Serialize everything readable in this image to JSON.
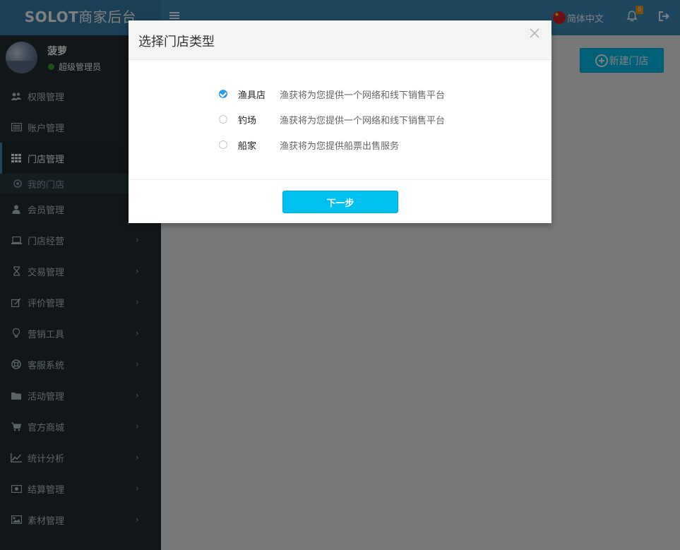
{
  "header": {
    "logo_latin": "SOLOT",
    "logo_cn": "商家后台",
    "hamburger_icon": "menu-icon",
    "language": "简体中文",
    "notification_count": "0",
    "colors": {
      "header": "#3c8dbc",
      "logo_bg": "#367fa9"
    }
  },
  "sidebar": {
    "user": {
      "name": "菠萝",
      "role": "超级管理员",
      "status_color": "#3c9a3c"
    },
    "items": [
      {
        "label": "权限管理",
        "icon": "users-icon"
      },
      {
        "label": "账户管理",
        "icon": "card-icon"
      },
      {
        "label": "门店管理",
        "icon": "grid-icon",
        "active": true
      },
      {
        "label": "我的门店",
        "icon": "circle-dot-icon",
        "sub": true
      },
      {
        "label": "会员管理",
        "icon": "user-icon"
      },
      {
        "label": "门店经营",
        "icon": "laptop-icon",
        "expandable": true
      },
      {
        "label": "交易管理",
        "icon": "hourglass-icon",
        "expandable": true
      },
      {
        "label": "评价管理",
        "icon": "edit-icon",
        "expandable": true
      },
      {
        "label": "营销工具",
        "icon": "lightbulb-icon",
        "expandable": true
      },
      {
        "label": "客服系统",
        "icon": "lifebuoy-icon",
        "expandable": true
      },
      {
        "label": "活动管理",
        "icon": "folder-icon",
        "expandable": true
      },
      {
        "label": "官方商城",
        "icon": "cart-icon",
        "expandable": true
      },
      {
        "label": "统计分析",
        "icon": "line-chart-icon",
        "expandable": true
      },
      {
        "label": "结算管理",
        "icon": "money-icon",
        "expandable": true
      },
      {
        "label": "素材管理",
        "icon": "image-icon",
        "expandable": true
      }
    ]
  },
  "content": {
    "new_store_label": "新建门店"
  },
  "modal": {
    "title": "选择门店类型",
    "options": [
      {
        "name": "渔具店",
        "desc": "渔获将为您提供一个网络和线下销售平台",
        "checked": true
      },
      {
        "name": "钓场",
        "desc": "渔获将为您提供一个网络和线下销售平台",
        "checked": false
      },
      {
        "name": "船家",
        "desc": "渔获将为您提供船票出售服务",
        "checked": false
      }
    ],
    "next_label": "下一步",
    "close_icon": "close-icon"
  }
}
